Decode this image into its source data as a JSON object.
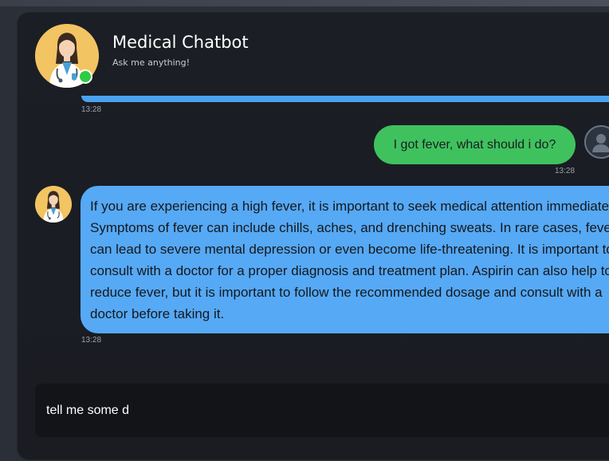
{
  "header": {
    "title": "Medical Chatbot",
    "subtitle": "Ask me anything!",
    "avatar_icon": "doctor-avatar-icon",
    "status": "online",
    "status_color": "#2ecc40"
  },
  "messages": [
    {
      "sender": "bot",
      "text": "",
      "time": "13:28",
      "truncated": true
    },
    {
      "sender": "user",
      "text": "I got fever, what should i do?",
      "time": "13:28",
      "avatar_icon": "user-avatar-icon"
    },
    {
      "sender": "bot",
      "text": "If you are experiencing a high fever, it is important to seek medical attention immediately. Symptoms of fever can include chills, aches, and drenching sweats. In rare cases, fever can lead to severe mental depression or even become life-threatening. It is important to consult with a doctor for a proper diagnosis and treatment plan. Aspirin can also help to reduce fever, but it is important to follow the recommended dosage and consult with a doctor before taking it.",
      "time": "13:28"
    }
  ],
  "input": {
    "value": "tell me some d",
    "placeholder": ""
  },
  "colors": {
    "bot_bubble": "#56a9f5",
    "user_bubble": "#3fc25e",
    "background": "#1b1e24"
  },
  "icons": {
    "send": "send-icon"
  }
}
